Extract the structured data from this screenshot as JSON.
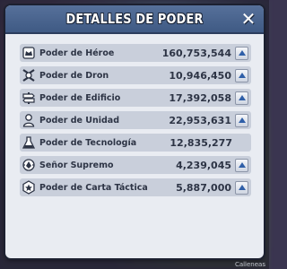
{
  "dialog": {
    "title": "DETALLES DE PODER",
    "close_glyph": "✕"
  },
  "corner_tag": "Calleneas",
  "rows": [
    {
      "label": "Poder de Héroe",
      "value": "160,753,544",
      "icon": "hero-icon",
      "expandable": true
    },
    {
      "label": "Poder de Dron",
      "value": "10,946,450",
      "icon": "drone-icon",
      "expandable": true
    },
    {
      "label": "Poder de Edificio",
      "value": "17,392,058",
      "icon": "building-icon",
      "expandable": true
    },
    {
      "label": "Poder de Unidad",
      "value": "22,953,631",
      "icon": "unit-icon",
      "expandable": true
    },
    {
      "label": "Poder de Tecnología",
      "value": "12,835,277",
      "icon": "flask-icon",
      "expandable": false
    },
    {
      "label": "Señor Supremo",
      "value": "4,239,045",
      "icon": "overlord-icon",
      "expandable": true
    },
    {
      "label": "Poder de Carta Táctica",
      "value": "5,887,000",
      "icon": "tactic-card-icon",
      "expandable": true
    }
  ],
  "colors": {
    "header": "#4a6590",
    "panel": "#e9ecf2",
    "row": "#c9cfdb",
    "text": "#2d3445"
  }
}
